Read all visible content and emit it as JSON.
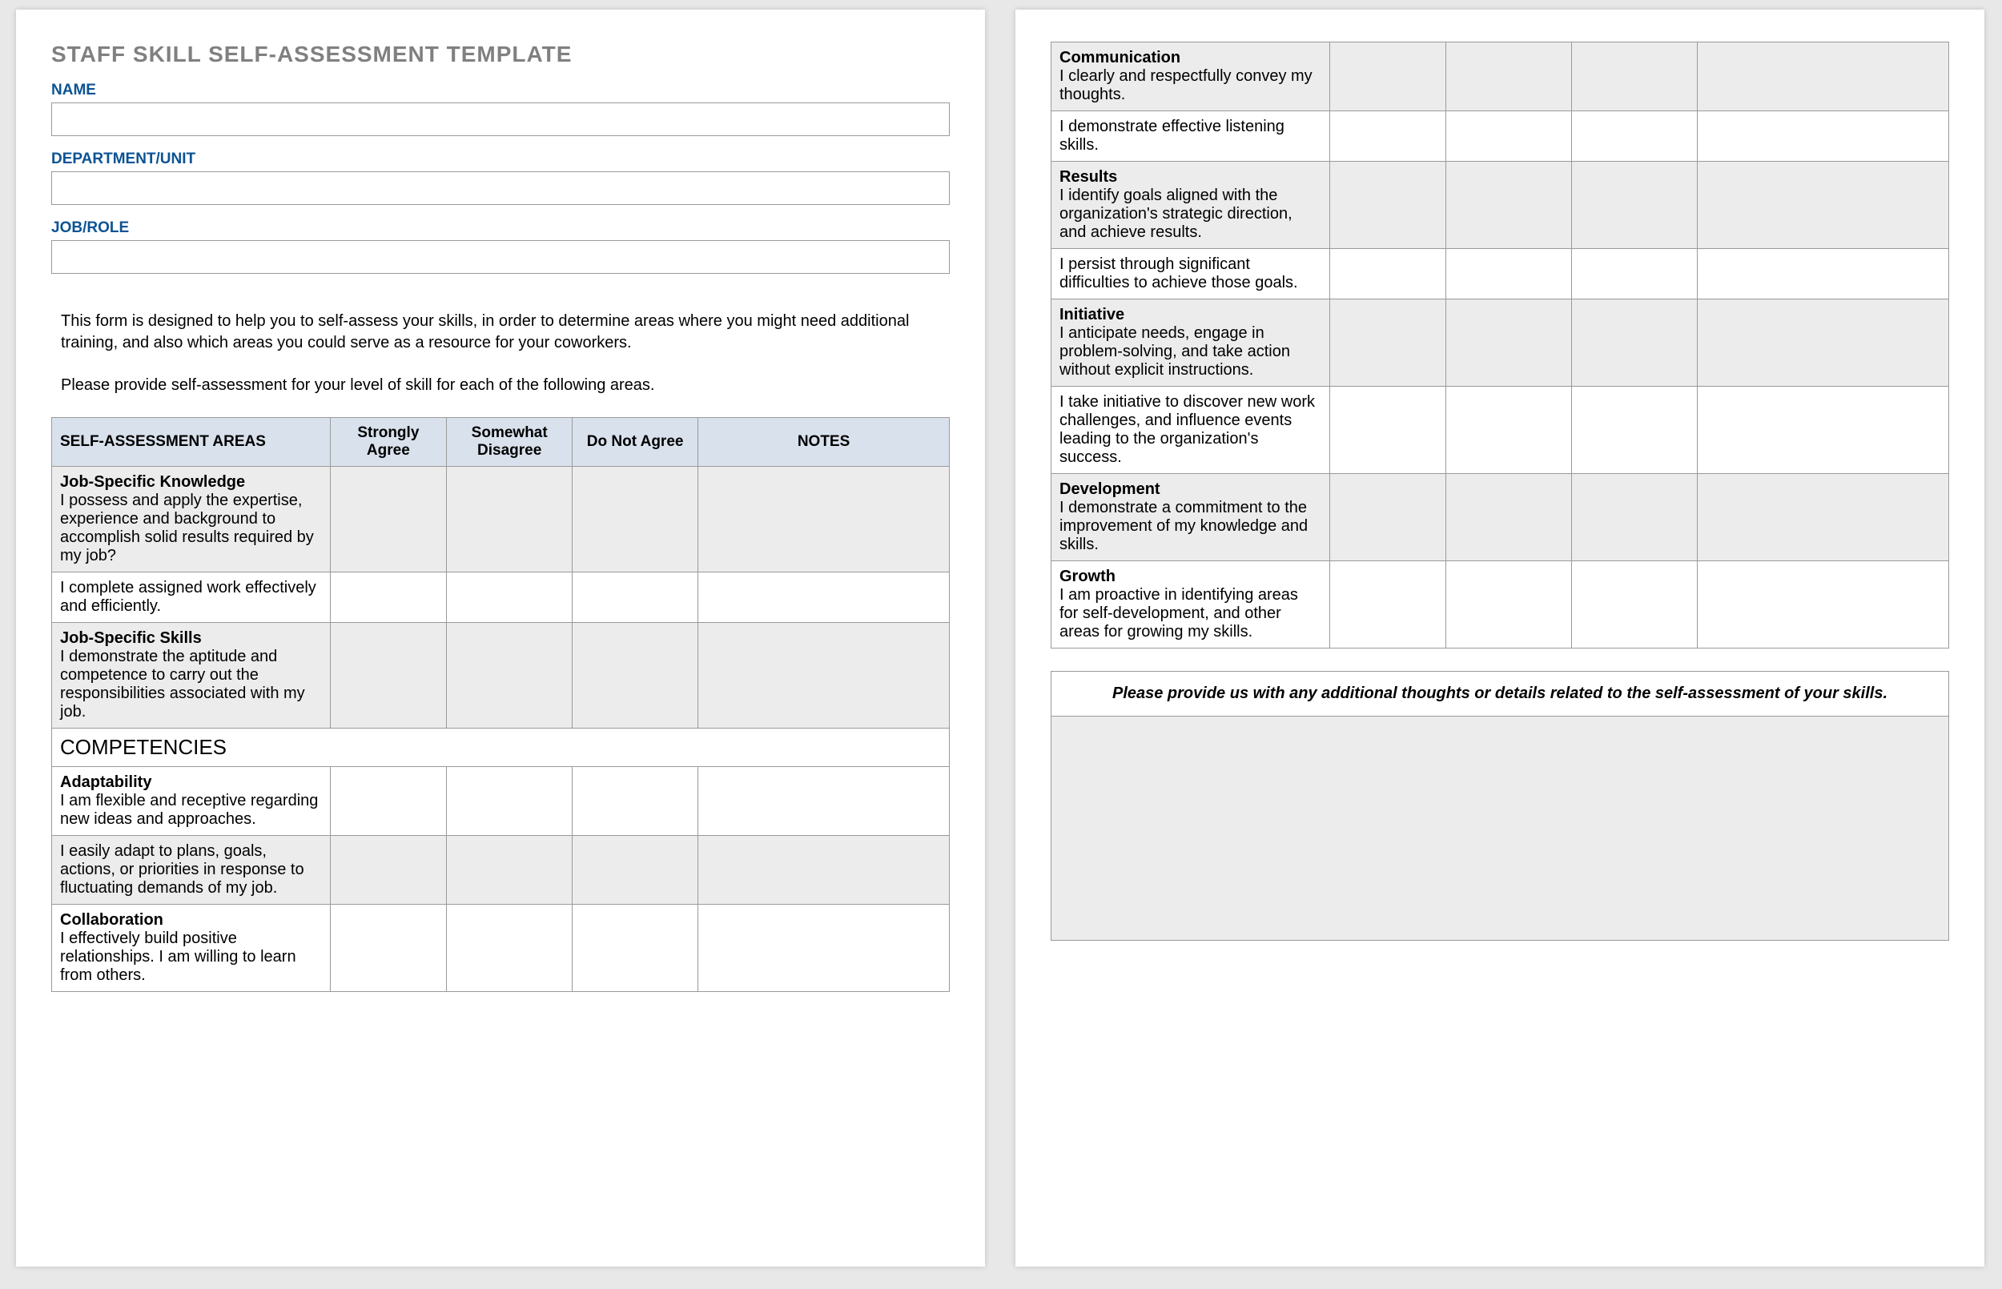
{
  "title": "STAFF SKILL SELF-ASSESSMENT TEMPLATE",
  "fields": {
    "name_label": "NAME",
    "dept_label": "DEPARTMENT/UNIT",
    "role_label": "JOB/ROLE"
  },
  "intro": {
    "p1": "This form is designed to help you to self-assess your skills, in order to determine areas where you might need additional training, and also which areas you could serve as a resource for your coworkers.",
    "p2": "Please provide self-assessment for your level of skill for each of the following areas."
  },
  "columns": {
    "area": "SELF-ASSESSMENT AREAS",
    "sa": "Strongly Agree",
    "sd": "Somewhat Disagree",
    "dna": "Do Not Agree",
    "notes": "NOTES"
  },
  "section_competencies": "COMPETENCIES",
  "rows_page1": [
    {
      "title": "Job-Specific Knowledge",
      "desc": "I possess and apply the expertise, experience and background to accomplish solid results required by my job?",
      "shade": true
    },
    {
      "title": "",
      "desc": "I complete assigned work effectively and efficiently.",
      "shade": false
    },
    {
      "title": "Job-Specific Skills",
      "desc": "I demonstrate the aptitude and competence to carry out the responsibilities associated with my job.",
      "shade": true
    }
  ],
  "rows_page1b": [
    {
      "title": "Adaptability",
      "desc": "I am flexible and receptive regarding new ideas and approaches.",
      "shade": false
    },
    {
      "title": "",
      "desc": "I easily adapt to plans, goals, actions, or priorities in response to fluctuating demands of my job.",
      "shade": true
    },
    {
      "title": "Collaboration",
      "desc": "I effectively build positive relationships. I am willing to learn from others.",
      "shade": false
    }
  ],
  "rows_page2": [
    {
      "title": "Communication",
      "desc": "I clearly and respectfully convey my thoughts.",
      "shade": true
    },
    {
      "title": "",
      "desc": "I demonstrate effective listening skills.",
      "shade": false
    },
    {
      "title": "Results",
      "desc": "I identify goals aligned with the organization's strategic direction, and achieve results.",
      "shade": true
    },
    {
      "title": "",
      "desc": "I persist through significant difficulties to achieve those goals.",
      "shade": false
    },
    {
      "title": "Initiative",
      "desc": "I anticipate needs, engage in problem-solving, and take action without explicit instructions.",
      "shade": true
    },
    {
      "title": "",
      "desc": "I take initiative to discover new work challenges, and influence events leading to the organization's success.",
      "shade": false
    },
    {
      "title": "Development",
      "desc": "I demonstrate a commitment to the improvement of my knowledge and skills.",
      "shade": true
    },
    {
      "title": "Growth",
      "desc": "I am proactive in identifying areas for self-development, and other areas for growing my skills.",
      "shade": false
    }
  ],
  "feedback_label": "Please provide us with any additional thoughts or details related to the self-assessment of your skills."
}
